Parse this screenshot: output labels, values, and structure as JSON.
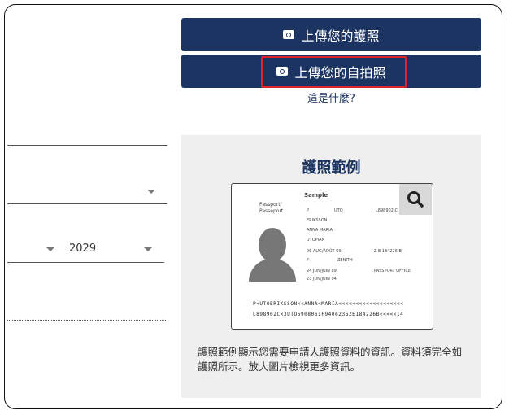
{
  "buttons": {
    "upload_passport": "上傳您的護照",
    "upload_selfie": "上傳您的自拍照",
    "icon": "camera-icon"
  },
  "whats_this": "這是什麼?",
  "form": {
    "year_value": "2029"
  },
  "sample": {
    "title": "護照範例",
    "passport": {
      "heading": "Sample",
      "label": "Passport/\nPasseport",
      "type": "P",
      "country": "UTO",
      "number": "L898902 C",
      "surname": "ERIKSSON",
      "given": "ANNA MARIA",
      "nationality": "UTOPIAN",
      "dob": "06 AUG/AOÛT 69",
      "personal_no": "Z E 184226 B",
      "sex": "F",
      "place": "ZENITH",
      "issue": "24 JUN/JUIN 89",
      "authority": "PASSPORT OFFICE",
      "expiry": "23 JUN/JUIN 94",
      "mrz1": "P<UTOERIKSSON<<ANNA<MARIA<<<<<<<<<<<<<<<<<<<",
      "mrz2": "L898902C<3UTO6908061F9406236ZE184226B<<<<<14"
    },
    "zoom_icon": "search-icon",
    "description": "護照範例顯示您需要申請人護照資料的資訊。資料須完全如護照所示。放大圖片檢視更多資訊。"
  }
}
